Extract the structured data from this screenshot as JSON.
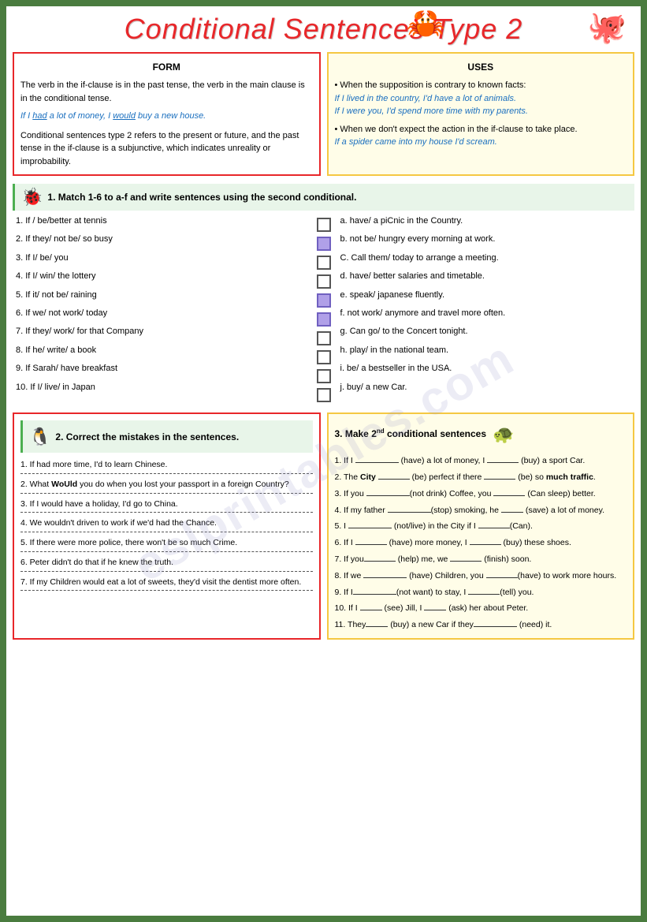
{
  "title": "Conditional Sentences Type 2",
  "form": {
    "title": "FORM",
    "body1": "The verb in the if-clause is in the past tense, the verb in the main clause is in the conditional tense.",
    "example1": "If I had a lot of money, I would buy a new house.",
    "body2": "Conditional sentences type 2 refers to the present or future, and the past tense in the if-clause is a subjunctive, which indicates unreality or improbability."
  },
  "uses": {
    "title": "USES",
    "bullet1": "When the supposition is contrary to known facts:",
    "ex1": "If I lived in the country, I'd have a lot of animals.",
    "ex2": "If I were you, I'd spend more time with my parents.",
    "bullet2": "When we don't expect the action in the if-clause to take place.",
    "ex3": "If a spider came into my house I'd scream."
  },
  "exercise1": {
    "header": "1. Match 1-6 to a-f and write sentences using the second conditional.",
    "left_items": [
      "1. If / be/better at tennis",
      "2. If they/ not be/ so busy",
      "3. If I/ be/ you",
      "4. If I/ win/ the lottery",
      "5. If it/ not be/ raining",
      "6. If we/ not work/ today",
      "7. If they/ work/ for that Company",
      "8. If he/ write/ a book",
      "9. If Sarah/ have breakfast",
      "10. If I/ live/ in Japan"
    ],
    "right_items": [
      "a. have/ a piCnic in the Country.",
      "b. not be/ hungry every morning at work.",
      "C. Call them/ today to arrange a meeting.",
      "d. have/ better salaries and timetable.",
      "e. speak/ japanese fluently.",
      "f. not work/ anymore and travel more often.",
      "g. Can go/ to the Concert tonight.",
      "h. play/ in the national team.",
      "i. be/ a bestseller in the USA.",
      "j. buy/ a new Car."
    ],
    "checkboxes_filled": [
      1,
      3,
      5
    ]
  },
  "exercise2": {
    "header": "2. Correct the mistakes in the sentences.",
    "items": [
      "1. If had more time, I'd to learn Chinese.",
      "2. What would you do when you lost your passport in a foreign Country?",
      "3. If I would have a holiday, I'd go to China.",
      "4. We wouldn't driven to work if we'd had the Chance.",
      "5. If there were more police, there won't be so much Crime.",
      "6. Peter didn't do that if he knew the truth.",
      "7. If my Children would eat a lot of sweets, they'd visit the dentist more often."
    ]
  },
  "exercise3": {
    "header": "3. Make 2nd conditional sentences",
    "items": [
      "1. If I _____ (have) a lot of money, I ____ (buy) a sport Car.",
      "2. The City ____ (be) perfect if there ____ (be) so much traffic.",
      "3. If you _____(not drink) Coffee, you ____ (Can sleep) better.",
      "4. If my father _____(stop) smoking, he ___ (save) a lot of money.",
      "5. I _____ (not/live) in the City if I ____(Can).",
      "6. If I ____ (have) more money, I ____ (buy) these shoes.",
      "7. If you____ (help) me, we ____ (finish) soon.",
      "8. If we _____ (have) Children, you ____(have) to work more hours.",
      "9. If I______(not want) to stay, I ____(tell) you.",
      "10. If I ___ (see) Jill, I ___ (ask) her about Peter.",
      "11. They___ (buy) a new Car if they_____ (need) it."
    ]
  },
  "watermark": "eslprintables.com"
}
